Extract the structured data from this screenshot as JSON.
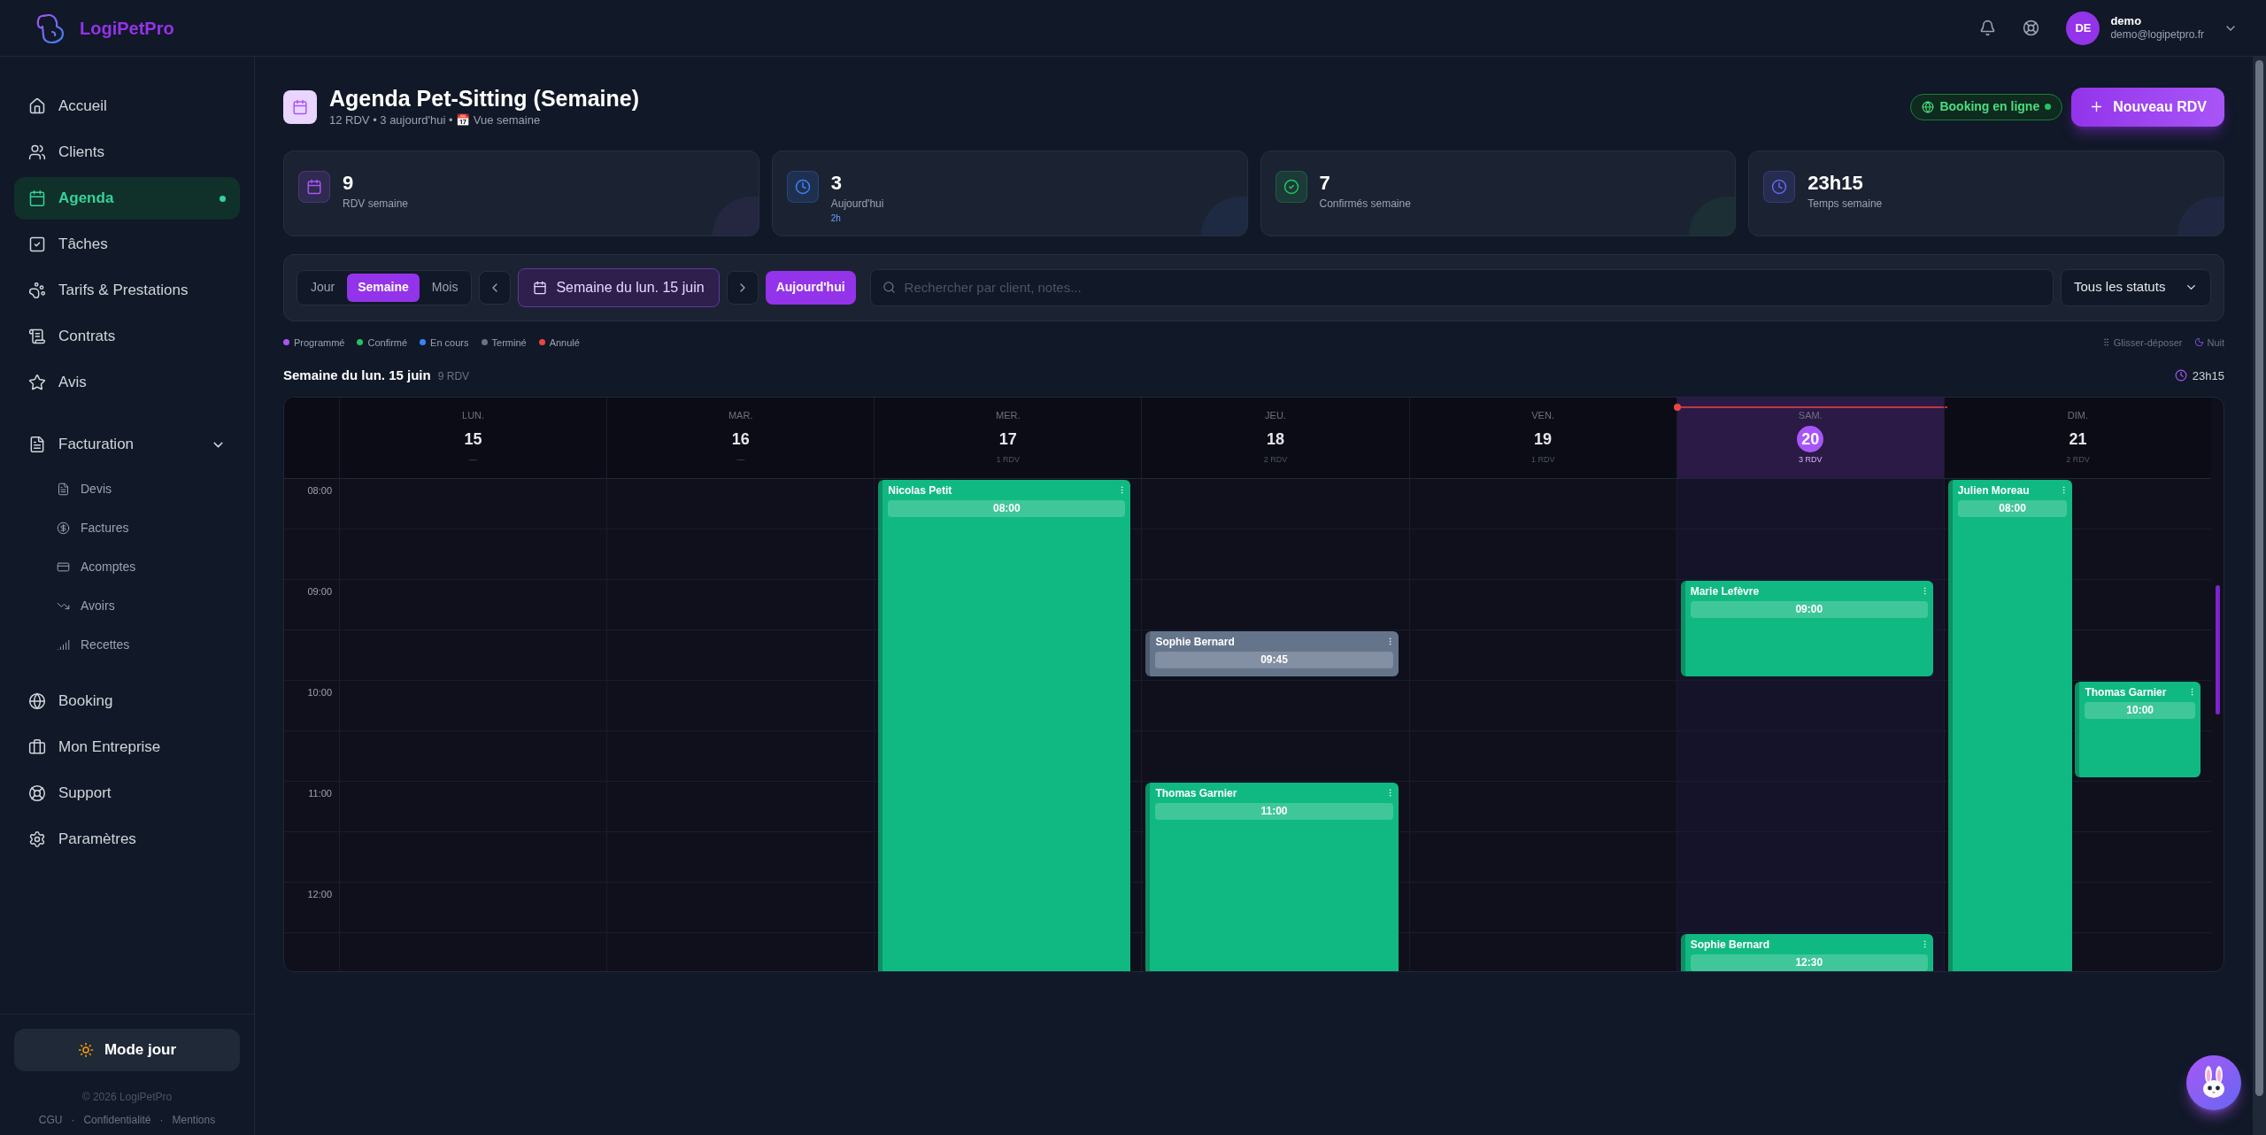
{
  "app": {
    "name": "LogiPetPro"
  },
  "user": {
    "initials": "DE",
    "name": "demo",
    "email": "demo@logipetpro.fr"
  },
  "sidebar": {
    "items": [
      {
        "label": "Accueil",
        "selected": false
      },
      {
        "label": "Clients",
        "selected": false
      },
      {
        "label": "Agenda",
        "selected": true
      },
      {
        "label": "Tâches",
        "selected": false
      },
      {
        "label": "Tarifs & Prestations",
        "selected": false
      },
      {
        "label": "Contrats",
        "selected": false
      },
      {
        "label": "Avis",
        "selected": false
      },
      {
        "label": "Facturation",
        "selected": false,
        "expanded": true,
        "children": [
          {
            "label": "Devis"
          },
          {
            "label": "Factures"
          },
          {
            "label": "Acomptes"
          },
          {
            "label": "Avoirs"
          },
          {
            "label": "Recettes"
          }
        ]
      },
      {
        "label": "Booking",
        "selected": false
      },
      {
        "label": "Mon Entreprise",
        "selected": false
      },
      {
        "label": "Support",
        "selected": false
      },
      {
        "label": "Paramètres",
        "selected": false
      }
    ],
    "mode_button": "Mode jour",
    "copyright": "© 2026 LogiPetPro",
    "footer_links": [
      "CGU",
      "Confidentialité",
      "Mentions"
    ],
    "separator": "·"
  },
  "page": {
    "title": "Agenda Pet-Sitting (Semaine)",
    "subtitle": "12 RDV • 3 aujourd'hui • 📅 Vue semaine",
    "booking_badge": {
      "label": "Booking en ligne",
      "on": true
    },
    "new_button": "Nouveau RDV"
  },
  "stats": [
    {
      "value": "9",
      "label": "RDV semaine",
      "color": "#a855f7"
    },
    {
      "value": "3",
      "label": "Aujourd'hui",
      "sub": "2h",
      "color": "#3b82f6"
    },
    {
      "value": "7",
      "label": "Confirmés semaine",
      "color": "#22c55e"
    },
    {
      "value": "23h15",
      "label": "Temps semaine",
      "color": "#6366f1"
    }
  ],
  "toolbar": {
    "views": [
      {
        "label": "Jour",
        "selected": false
      },
      {
        "label": "Semaine",
        "selected": true
      },
      {
        "label": "Mois",
        "selected": false
      }
    ],
    "week_label": "Semaine du lun. 15 juin",
    "today_button": "Aujourd'hui",
    "search_placeholder": "Rechercher par client, notes...",
    "status_filter": "Tous les statuts"
  },
  "legend": [
    {
      "label": "Programmé",
      "color": "#a855f7"
    },
    {
      "label": "Confirmé",
      "color": "#22c55e"
    },
    {
      "label": "En cours",
      "color": "#3b82f6"
    },
    {
      "label": "Terminé",
      "color": "#6b7280"
    },
    {
      "label": "Annulé",
      "color": "#ef4444"
    }
  ],
  "hints": [
    "Glisser-déposer",
    "Nuit"
  ],
  "week": {
    "title": "Semaine du lun. 15 juin",
    "count": "9 RDV",
    "total": "23h15"
  },
  "calendar": {
    "times": [
      "08:00",
      "09:00",
      "10:00",
      "11:00",
      "12:00"
    ],
    "days": [
      {
        "weekday": "LUN.",
        "date": "15",
        "count": "—",
        "selected": false
      },
      {
        "weekday": "MAR.",
        "date": "16",
        "count": "—",
        "selected": false
      },
      {
        "weekday": "MER.",
        "date": "17",
        "count": "1 RDV",
        "selected": false,
        "events": [
          {
            "client": "Nicolas Petit",
            "time": "08:00",
            "color": "#10b981",
            "kind": "long"
          }
        ]
      },
      {
        "weekday": "JEU.",
        "date": "18",
        "count": "2 RDV",
        "selected": false,
        "events": [
          {
            "client": "Sophie Bernard",
            "time": "09:45",
            "color": "#64748b",
            "kind": "short"
          },
          {
            "client": "Thomas Garnier",
            "time": "11:00",
            "color": "#10b981",
            "kind": "long"
          }
        ]
      },
      {
        "weekday": "VEN.",
        "date": "19",
        "count": "1 RDV",
        "selected": false
      },
      {
        "weekday": "SAM.",
        "date": "20",
        "count": "3 RDV",
        "selected": true,
        "events": [
          {
            "client": "Marie Lefèvre",
            "time": "09:00",
            "color": "#10b981",
            "kind": "hour"
          },
          {
            "client": "Sophie Bernard",
            "time": "12:30",
            "color": "#10b981",
            "kind": "long"
          }
        ]
      },
      {
        "weekday": "DIM.",
        "date": "21",
        "count": "2 RDV",
        "selected": false,
        "events": [
          {
            "client": "Julien Moreau",
            "time": "08:00",
            "color": "#10b981",
            "kind": "long"
          },
          {
            "client": "Thomas Garnier",
            "time": "10:00",
            "color": "#10b981",
            "kind": "hour"
          }
        ]
      }
    ]
  }
}
